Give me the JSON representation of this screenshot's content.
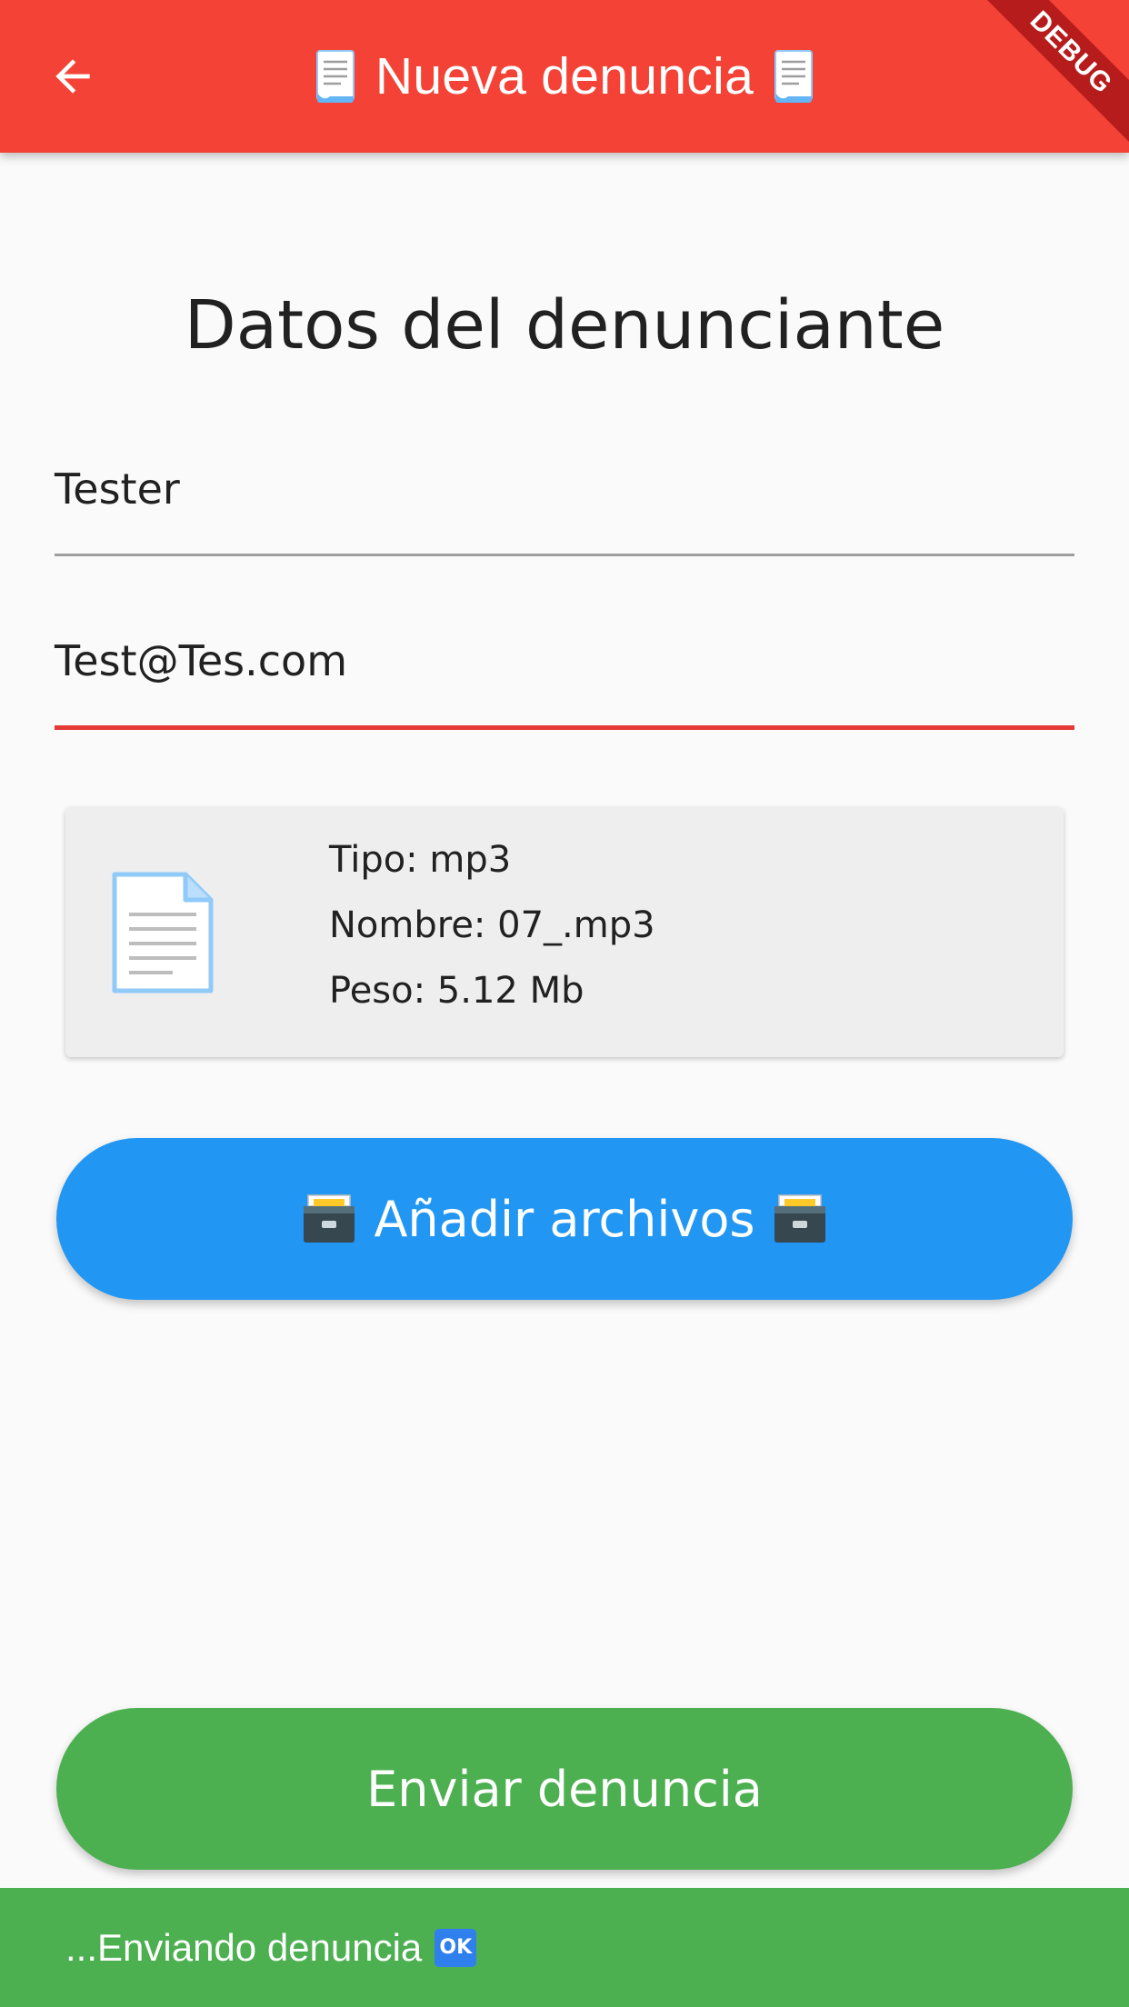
{
  "appbar": {
    "title": "Nueva denuncia",
    "back_icon": "arrow-back-icon",
    "title_icon": "page-facing-up-icon",
    "color": "#F44336"
  },
  "debug_banner": {
    "label": "DEBUG"
  },
  "form": {
    "section_title": "Datos del denunciante",
    "name_value": "Tester",
    "email_value": "Test@Tes.com",
    "focus_color": "#E53935"
  },
  "file": {
    "icon": "document-icon",
    "type_line": "Tipo: mp3",
    "name_line": "Nombre: 07_.mp3",
    "size_line": "Peso: 5.12 Mb"
  },
  "buttons": {
    "add_files_label": "Añadir archivos",
    "add_files_icon": "card-file-box-icon",
    "add_files_color": "#2196F3",
    "send_label": "Enviar denuncia",
    "send_color": "#4CAF50"
  },
  "snackbar": {
    "message": "...Enviando denuncia",
    "badge": "OK",
    "color": "#4CAF50"
  }
}
